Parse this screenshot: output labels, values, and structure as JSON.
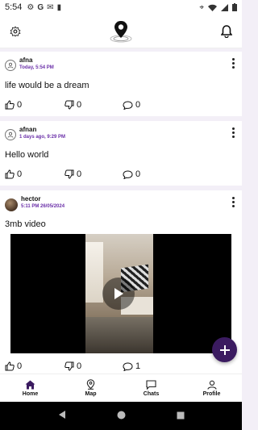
{
  "status_bar": {
    "time": "5:54",
    "left_icons": [
      "gear-icon",
      "google-icon",
      "gmail-icon",
      "sd-card-icon"
    ],
    "right_icons": [
      "location-icon",
      "wifi-icon",
      "signal-icon",
      "battery-icon"
    ]
  },
  "header": {
    "settings_icon": "gear-icon",
    "logo_icon": "location-pin-logo-icon",
    "notification_icon": "bell-icon"
  },
  "posts": [
    {
      "username": "afna",
      "time": "Today, 5:54 PM",
      "text": "life would be a dream",
      "likes": "0",
      "dislikes": "0",
      "comments": "0"
    },
    {
      "username": "afnan",
      "time": "1 days ago, 9:29 PM",
      "text": "Hello world",
      "likes": "0",
      "dislikes": "0",
      "comments": "0"
    },
    {
      "username": "hector",
      "time": "5:11 PM 26/05/2024",
      "text": "3mb video",
      "likes": "0",
      "dislikes": "0",
      "comments": "1"
    }
  ],
  "fab": {
    "icon": "plus-icon"
  },
  "bottom_nav": [
    {
      "label": "Home",
      "icon": "home-icon",
      "active": true
    },
    {
      "label": "Map",
      "icon": "map-pin-icon",
      "active": false
    },
    {
      "label": "Chats",
      "icon": "chat-icon",
      "active": false
    },
    {
      "label": "Profile",
      "icon": "user-icon",
      "active": false
    }
  ],
  "colors": {
    "accent": "#3b1b60",
    "time_label": "#6a2fa8",
    "feed_background": "#f3eff7"
  }
}
